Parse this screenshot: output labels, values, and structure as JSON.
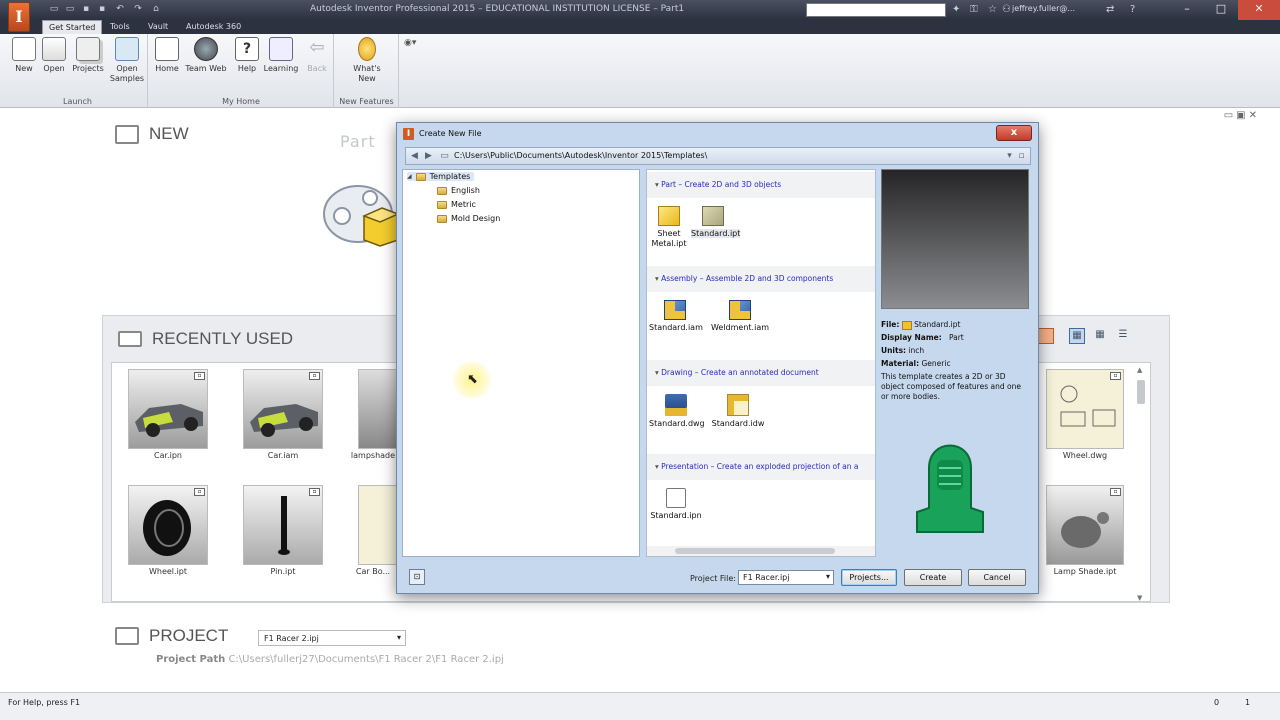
{
  "titlebar": {
    "title": "Autodesk Inventor Professional 2015 – EDUCATIONAL INSTITUTION LICENSE – Part1",
    "app_button_label": "I",
    "user": "jeffrey.fuller@..."
  },
  "ribbon_tabs": [
    "Get Started",
    "Tools",
    "Vault",
    "Autodesk 360"
  ],
  "ribbon": {
    "launch": {
      "label": "Launch",
      "new": "New",
      "open": "Open",
      "projects": "Projects",
      "open_samples_1": "Open",
      "open_samples_2": "Samples"
    },
    "my_home": {
      "label": "My Home",
      "home": "Home",
      "team_web": "Team Web",
      "help": "Help",
      "learning": "Learning",
      "back": "Back"
    },
    "new_features": {
      "label": "New Features",
      "whats_new_1": "What's",
      "whats_new_2": "New"
    }
  },
  "home": {
    "new_header": "NEW",
    "part_label": "Part",
    "recent_header": "RECENTLY USED",
    "recent_row1": [
      {
        "name": "Car.ipn"
      },
      {
        "name": "Car.iam"
      },
      {
        "name": "lampshade"
      },
      {
        "name": "Wheel.dwg"
      }
    ],
    "recent_row2": [
      {
        "name": "Wheel.ipt"
      },
      {
        "name": "Pin.ipt"
      },
      {
        "name": "Car Bo..."
      },
      {
        "name": "Lamp Shade.ipt"
      }
    ],
    "project_header": "PROJECT",
    "project_select": "F1 Racer 2.ipj",
    "project_path_label": "Project Path",
    "project_path": "C:\\Users\\fullerj27\\Documents\\F1 Racer 2\\F1 Racer 2.ipj"
  },
  "dialog": {
    "title": "Create New File",
    "close_label": "x",
    "path": "C:\\Users\\Public\\Documents\\Autodesk\\Inventor 2015\\Templates\\",
    "tree": {
      "root": "Templates",
      "children": [
        "English",
        "Metric",
        "Mold Design"
      ]
    },
    "sections": [
      {
        "title": "Part – Create 2D and 3D objects",
        "items": [
          "Sheet Metal.ipt",
          "Standard.ipt"
        ]
      },
      {
        "title": "Assembly – Assemble 2D and 3D components",
        "items": [
          "Standard.iam",
          "Weldment.iam"
        ]
      },
      {
        "title": "Drawing – Create an annotated document",
        "items": [
          "Standard.dwg",
          "Standard.idw"
        ]
      },
      {
        "title": "Presentation – Create an exploded projection of an a",
        "items": [
          "Standard.ipn"
        ]
      }
    ],
    "info": {
      "file_label": "File:",
      "file": "Standard.ipt",
      "display_name_label": "Display Name:",
      "display_name": "Part",
      "units_label": "Units:",
      "units": "inch",
      "material_label": "Material:",
      "material": "Generic",
      "description": "This template creates a 2D or 3D object composed of features and one or more bodies."
    },
    "project_file_label": "Project File:",
    "project_file": "F1 Racer.ipj",
    "projects_button": "Projects...",
    "create_button": "Create",
    "cancel_button": "Cancel"
  },
  "status": {
    "text": "For Help, press F1",
    "count1": "0",
    "count2": "1"
  },
  "colors": {
    "title_bar": "#2c3140",
    "dialog_frame": "#c6d8ee",
    "section_link": "#2b2bbd",
    "cursor_highlight": "#fff278"
  }
}
